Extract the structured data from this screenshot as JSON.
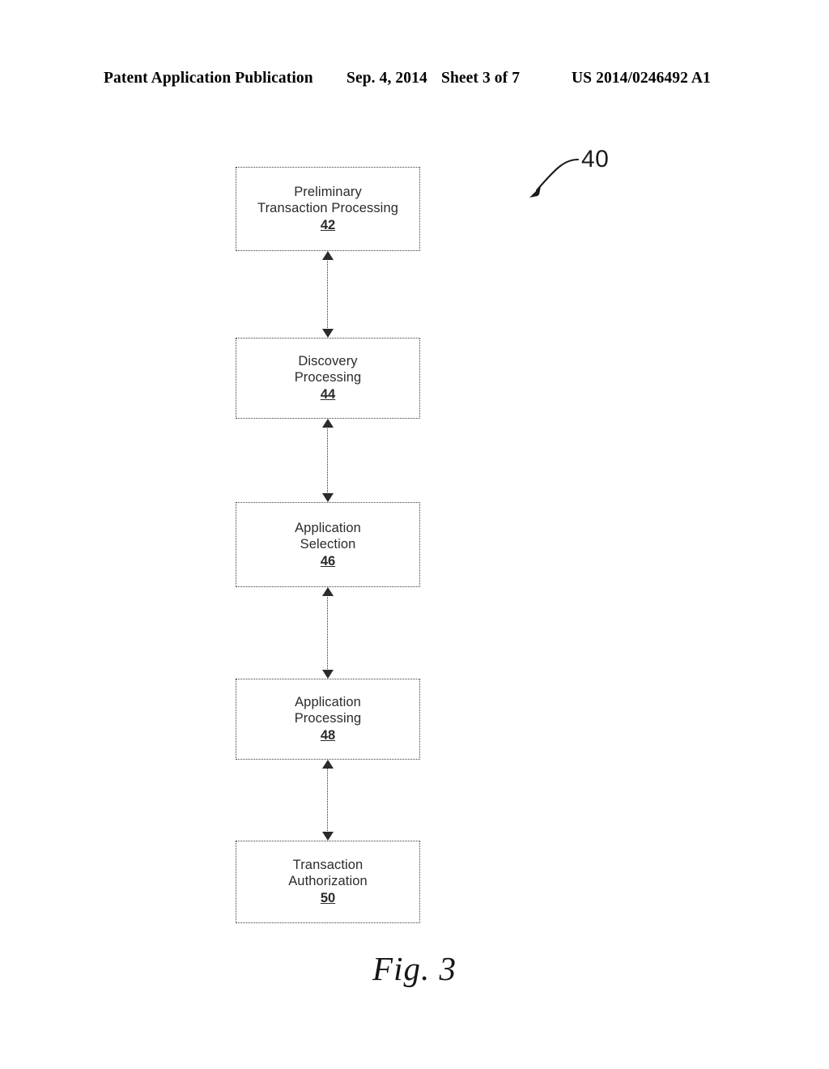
{
  "header": {
    "publication": "Patent Application Publication",
    "date": "Sep. 4, 2014",
    "sheet": "Sheet 3 of 7",
    "patent_number": "US 2014/0246492 A1"
  },
  "figure": {
    "caption": "Fig. 3",
    "system_reference": "40",
    "boxes": [
      {
        "line1": "Preliminary",
        "line2": "Transaction Processing",
        "ref": "42"
      },
      {
        "line1": "Discovery",
        "line2": "Processing",
        "ref": "44"
      },
      {
        "line1": "Application",
        "line2": "Selection",
        "ref": "46"
      },
      {
        "line1": "Application",
        "line2": "Processing",
        "ref": "48"
      },
      {
        "line1": "Transaction",
        "line2": "Authorization",
        "ref": "50"
      }
    ],
    "connectors": [
      {
        "from": "42",
        "to": "44",
        "style": "double-headed-arrow"
      },
      {
        "from": "44",
        "to": "46",
        "style": "double-headed-arrow"
      },
      {
        "from": "46",
        "to": "48",
        "style": "double-headed-arrow"
      },
      {
        "from": "48",
        "to": "50",
        "style": "double-headed-arrow"
      }
    ]
  },
  "colors": {
    "ink": "#2b2b2b",
    "background": "#ffffff"
  }
}
